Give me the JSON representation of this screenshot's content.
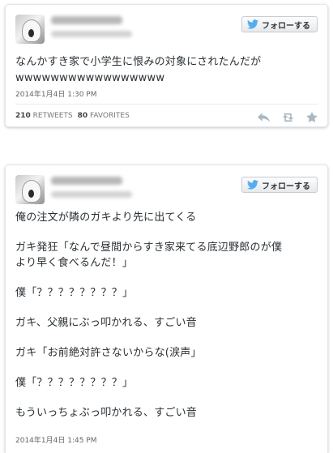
{
  "tweets": [
    {
      "follow_label": "フォローする",
      "text": "なんかすき家で小学生に恨みの対象にされたんだが\nwwwwwwwwwwwwwwwww",
      "timestamp": "2014年1月4日 1:30 PM",
      "retweets_count": "210",
      "retweets_label": "RETWEETS",
      "favorites_count": "80",
      "favorites_label": "FAVORITES"
    },
    {
      "follow_label": "フォローする",
      "text": "俺の注文が隣のガキより先に出てくる\n\nガキ発狂「なんで昼間からすき家来てる底辺野郎のが僕\nより早く食べるんだ！」\n\n僕「？？？？？？？？」\n\nガキ、父親にぶっ叩かれる、すごい音\n\nガキ「お前絶対許さないからな(涙声」\n\n僕「？？？？？？？？」\n\nもういっちょぶっ叩かれる、すごい音",
      "timestamp": "2014年1月4日 1:45 PM"
    }
  ],
  "icons": {
    "follow_icon": "twitter-bird-icon",
    "reply": "reply-icon",
    "retweet": "retweet-icon",
    "favorite": "star-icon"
  }
}
